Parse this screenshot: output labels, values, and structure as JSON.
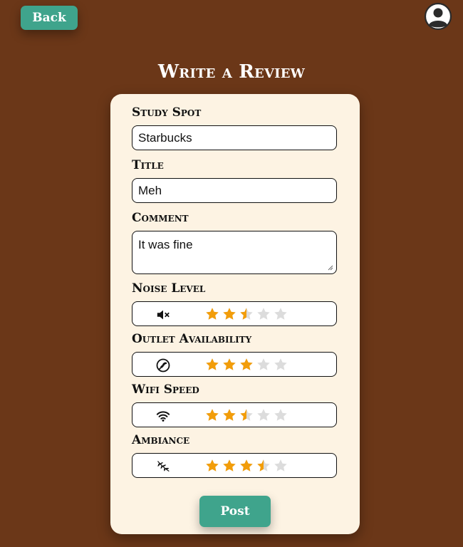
{
  "header": {
    "back_label": "Back",
    "page_title": "Write a Review"
  },
  "form": {
    "study_spot": {
      "label": "Study Spot",
      "value": "Starbucks"
    },
    "title": {
      "label": "Title",
      "value": "Meh"
    },
    "comment": {
      "label": "Comment",
      "value": "It was fine"
    },
    "ratings": [
      {
        "label": "Noise Level",
        "icon": "muted-speaker-icon",
        "value": 2.5,
        "max": 5
      },
      {
        "label": "Outlet Availability",
        "icon": "plug-icon",
        "value": 3,
        "max": 5
      },
      {
        "label": "Wifi Speed",
        "icon": "wifi-icon",
        "value": 2.5,
        "max": 5
      },
      {
        "label": "Ambiance",
        "icon": "leaf-icon",
        "value": 3.5,
        "max": 5
      }
    ],
    "post_label": "Post"
  },
  "colors": {
    "background": "#6b3718",
    "card": "#fdf3e3",
    "accent": "#3fa48c",
    "star_filled": "#f29d0a",
    "star_empty": "#dcdcdc"
  }
}
